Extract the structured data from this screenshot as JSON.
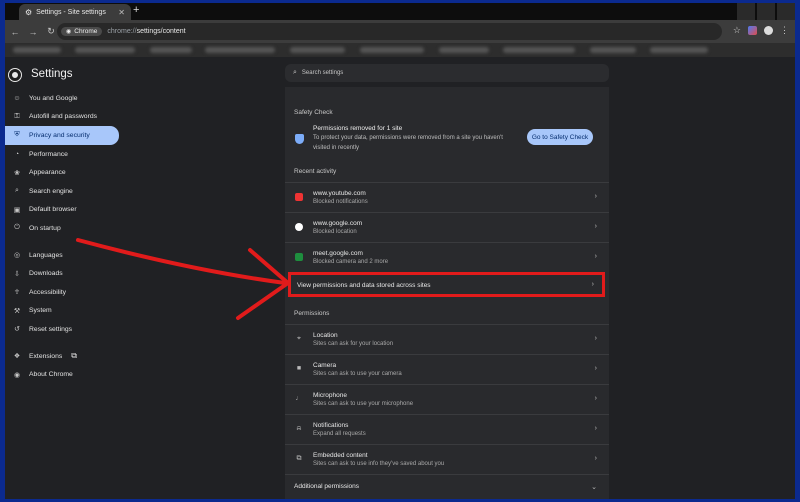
{
  "browser": {
    "tab_title": "Settings - Site settings",
    "new_tab": "+",
    "chip_label": "Chrome",
    "url_host": "chrome://",
    "url_path": "settings/content"
  },
  "settings": {
    "title": "Settings",
    "search_placeholder": "Search settings",
    "sidebar": [
      {
        "label": "You and Google",
        "icon": "person-icon",
        "glyph": "☺"
      },
      {
        "label": "Autofill and passwords",
        "icon": "key-icon",
        "glyph": "⚿"
      },
      {
        "label": "Privacy and security",
        "icon": "shield-icon",
        "glyph": "⛨"
      },
      {
        "label": "Performance",
        "icon": "speedometer-icon",
        "glyph": "◔"
      },
      {
        "label": "Appearance",
        "icon": "palette-icon",
        "glyph": "❀"
      },
      {
        "label": "Search engine",
        "icon": "search-icon",
        "glyph": "⌕"
      },
      {
        "label": "Default browser",
        "icon": "browser-icon",
        "glyph": "▣"
      },
      {
        "label": "On startup",
        "icon": "power-icon",
        "glyph": "⏻"
      },
      {
        "label": "Languages",
        "icon": "globe-icon",
        "glyph": "◎"
      },
      {
        "label": "Downloads",
        "icon": "download-icon",
        "glyph": "⇩"
      },
      {
        "label": "Accessibility",
        "icon": "accessibility-icon",
        "glyph": "☥"
      },
      {
        "label": "System",
        "icon": "wrench-icon",
        "glyph": "⚒"
      },
      {
        "label": "Reset settings",
        "icon": "reset-icon",
        "glyph": "↺"
      },
      {
        "label": "Extensions",
        "icon": "puzzle-icon",
        "glyph": "❖"
      },
      {
        "label": "About Chrome",
        "icon": "chrome-icon",
        "glyph": "◉"
      }
    ],
    "active_item": "Privacy and security",
    "safety_check": {
      "heading": "Safety Check",
      "title": "Permissions removed for 1 site",
      "description": "To protect your data, permissions were removed from a site you haven't visited in recently",
      "button": "Go to Safety Check"
    },
    "recent_activity": {
      "heading": "Recent activity",
      "items": [
        {
          "site": "www.youtube.com",
          "detail": "Blocked notifications"
        },
        {
          "site": "www.google.com",
          "detail": "Blocked location"
        },
        {
          "site": "meet.google.com",
          "detail": "Blocked camera and 2 more"
        }
      ]
    },
    "view_permissions": "View permissions and data stored across sites",
    "permissions": {
      "heading": "Permissions",
      "items": [
        {
          "title": "Location",
          "detail": "Sites can ask for your location",
          "icon": "location-icon",
          "glyph": "⌖"
        },
        {
          "title": "Camera",
          "detail": "Sites can ask to use your camera",
          "icon": "camera-icon",
          "glyph": "■"
        },
        {
          "title": "Microphone",
          "detail": "Sites can ask to use your microphone",
          "icon": "microphone-icon",
          "glyph": "♩"
        },
        {
          "title": "Notifications",
          "detail": "Expand all requests",
          "icon": "bell-icon",
          "glyph": "⍾"
        },
        {
          "title": "Embedded content",
          "detail": "Sites can ask to use info they've saved about you",
          "icon": "embedded-content-icon",
          "glyph": "⧉"
        }
      ],
      "additional": "Additional permissions"
    }
  },
  "colors": {
    "frame_border": "#0b2a8f",
    "annotation": "#e11b1b",
    "accent": "#a8c7fa"
  }
}
